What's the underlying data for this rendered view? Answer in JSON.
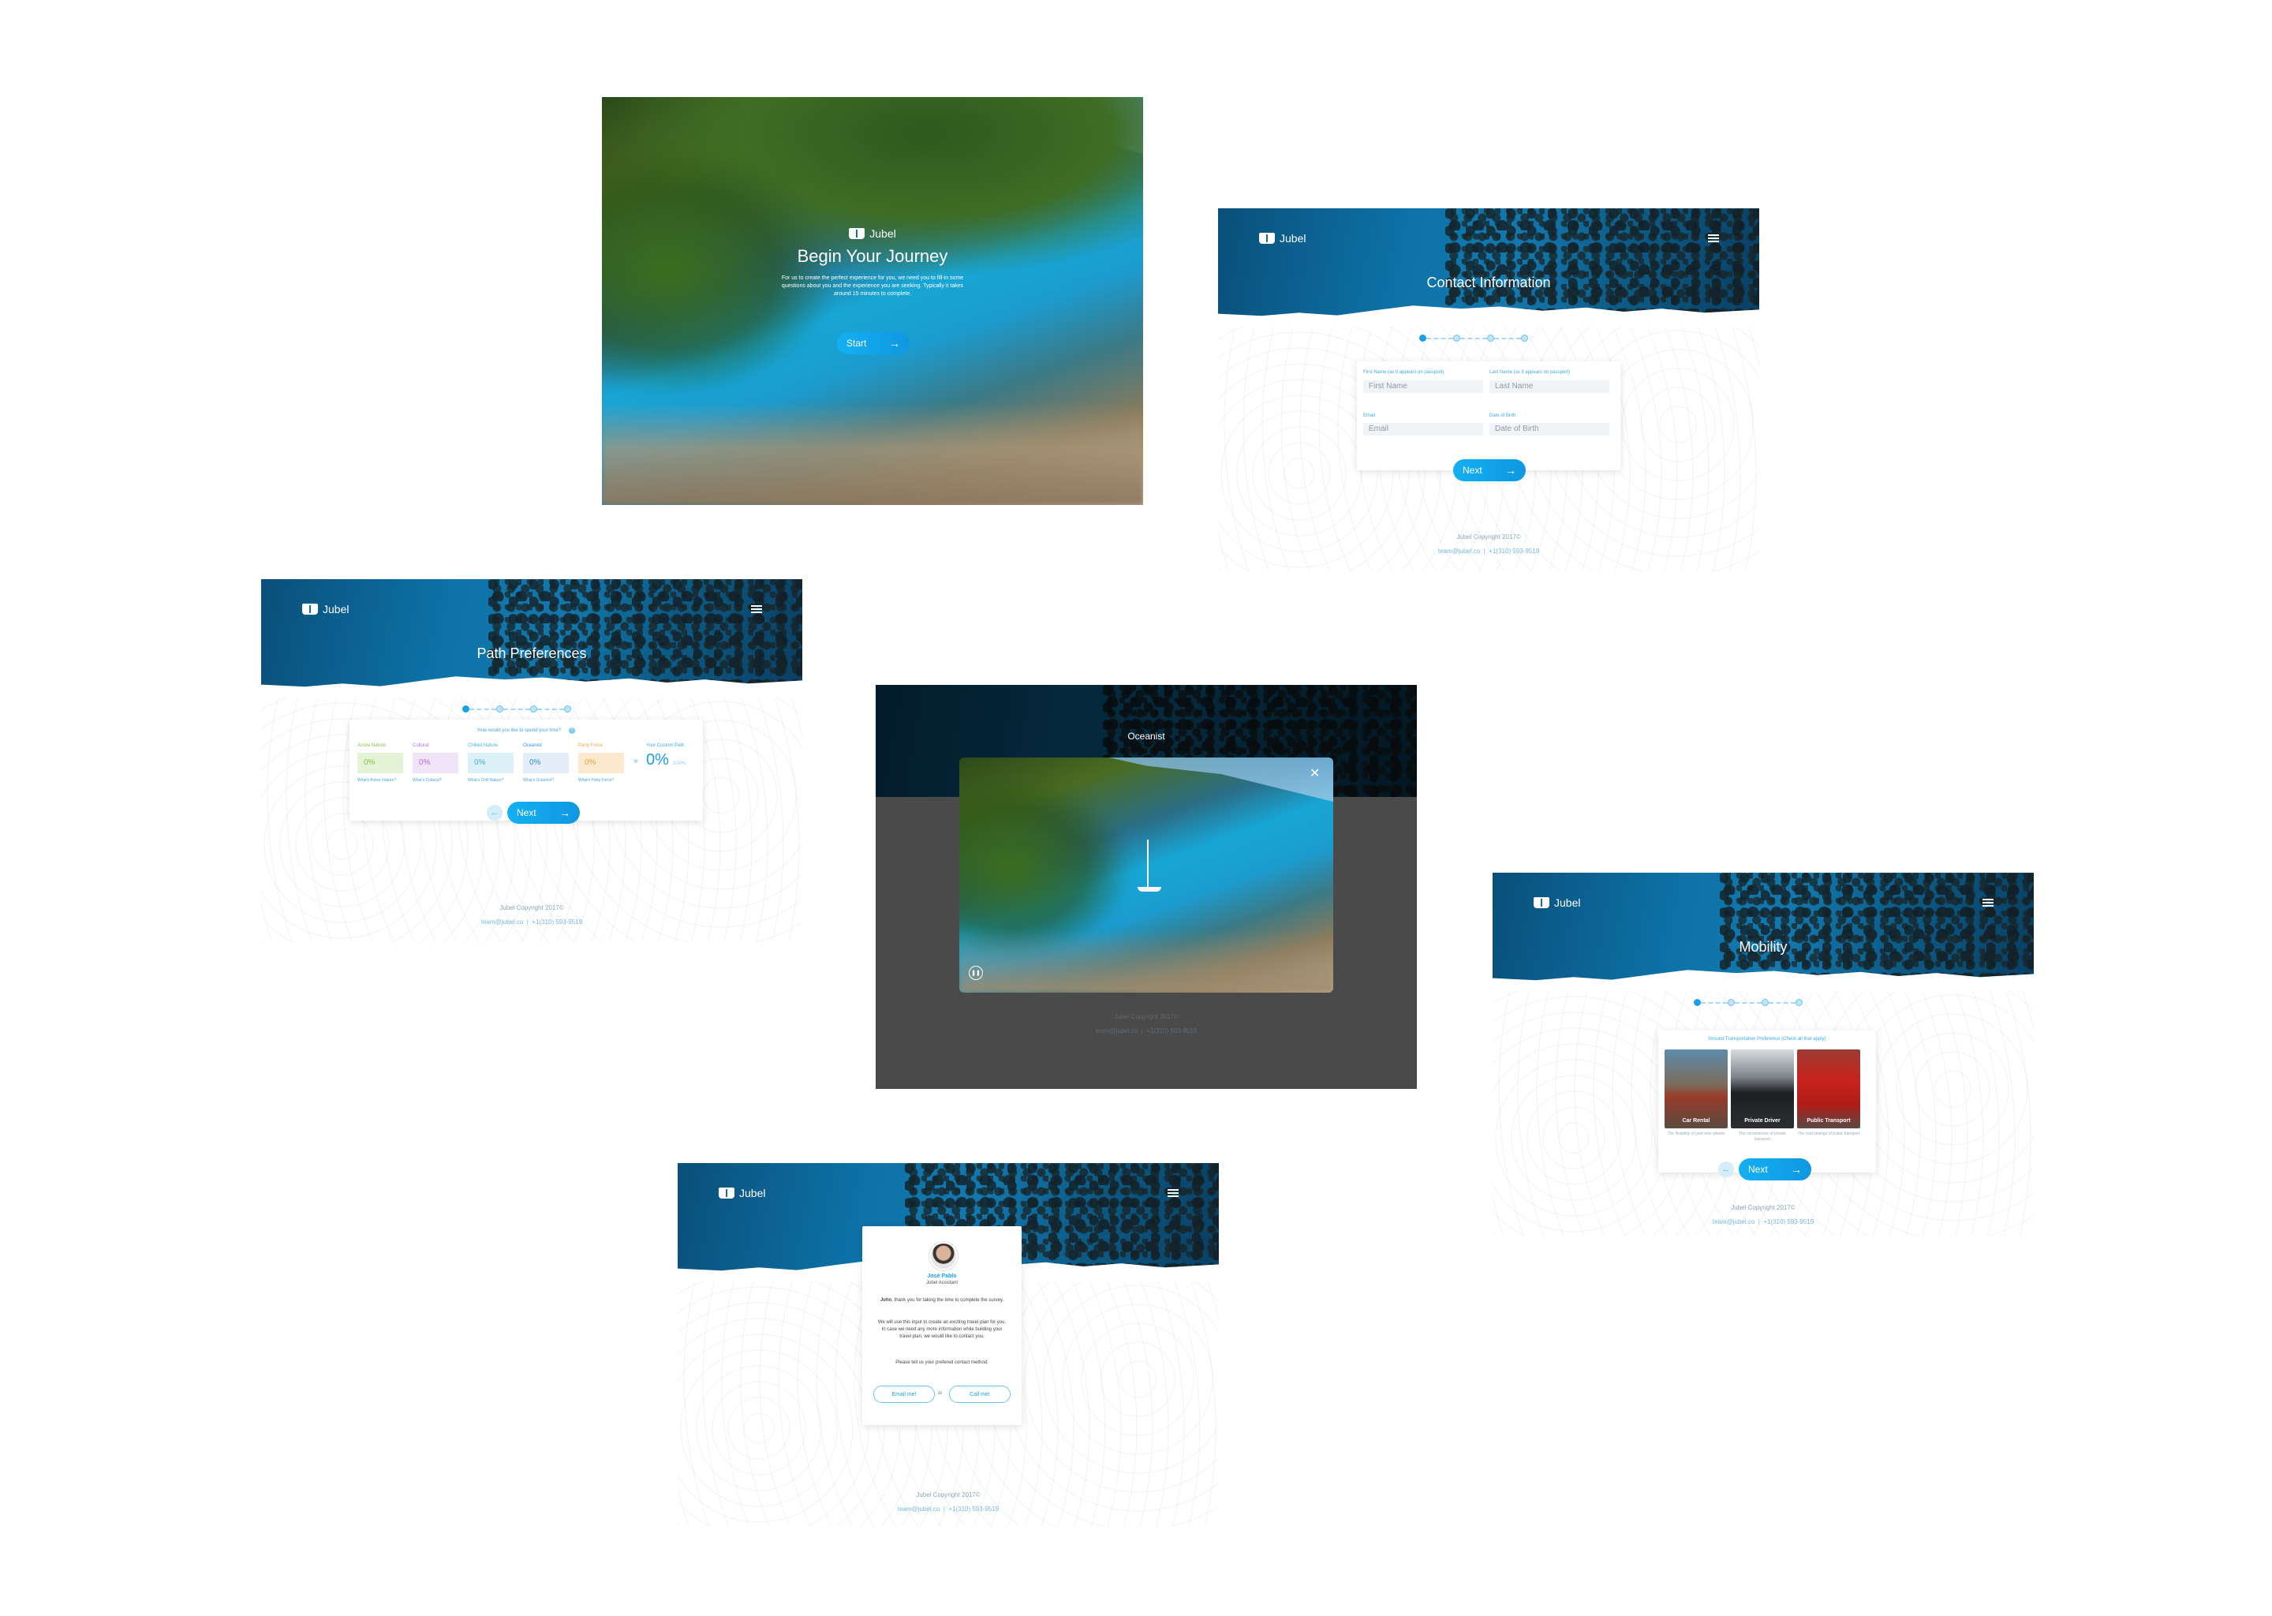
{
  "brand": "Jubel",
  "begin": {
    "title": "Begin Your Journey",
    "body": "For us to create the perfect experience for you, we need you to fill-in some questions about you and the experience you are seeking. Typically it takes around 15 minutes to complete.",
    "start_label": "Start"
  },
  "contact": {
    "title": "Contact Information",
    "first_label": "First Name (as it appears on passport)",
    "first_placeholder": "First Name",
    "last_label": "Last Name (as it appears on passport)",
    "last_placeholder": "Last Name",
    "email_label": "Email",
    "email_placeholder": "Email",
    "dob_label": "Date of Birth",
    "dob_placeholder": "Date of Birth",
    "next_label": "Next"
  },
  "path": {
    "title": "Path Preferences",
    "question": "How would you like to spend your time?",
    "categories": [
      {
        "name": "Active Nature",
        "value": "0%",
        "what": "What's Active Nature?",
        "color": "#8bc34a",
        "bg": "#e4f3d6"
      },
      {
        "name": "Cultural",
        "value": "0%",
        "what": "What's Cultural?",
        "color": "#b76ee0",
        "bg": "#f1e4f8"
      },
      {
        "name": "Chilled Nature",
        "value": "0%",
        "what": "What's Chill Nature?",
        "color": "#3fb8d8",
        "bg": "#dcf1f7"
      },
      {
        "name": "Oceanist",
        "value": "0%",
        "what": "What's Oceanist?",
        "color": "#2e8fe0",
        "bg": "#e3eef8"
      },
      {
        "name": "Party Force",
        "value": "0%",
        "what": "What's Party Force?",
        "color": "#f4a23c",
        "bg": "#fde9cf"
      }
    ],
    "equals": "=",
    "custom_label": "Your Custom Path",
    "custom_value": "0%",
    "custom_suffix": "/100%",
    "next_label": "Next",
    "back_label": "←"
  },
  "modal": {
    "title": "Oceanist",
    "close_label": "✕",
    "pause_label": "❚❚"
  },
  "mobility": {
    "title": "Mobility",
    "question": "Ground Transportation Preference (Check all that apply)",
    "options": [
      {
        "label": "Car Rental",
        "desc": "The flexibility of your own wheels"
      },
      {
        "label": "Private Driver",
        "desc": "The convenience of private transport"
      },
      {
        "label": "Public Transport",
        "desc": "The cost savings of public transport"
      }
    ],
    "next_label": "Next"
  },
  "assistant": {
    "name": "José Pablo",
    "role": "Jubel Assistant",
    "greeting_name": "John",
    "greeting": ", thank you for taking the time to complete the survey.",
    "body": "We will use this input to create an exciting travel plan for you. In case we need any more information while building your travel plan, we would like to contact you.",
    "prompt": "Please tell us your prefered contact method:",
    "email_label": "Email me!",
    "or_label": "or",
    "call_label": "Call me!"
  },
  "footer": {
    "copyright": "Jubel Copyright 2017©",
    "email": "team@jubel.co",
    "separator": "|",
    "phone": "+1(310) 593-9519"
  }
}
